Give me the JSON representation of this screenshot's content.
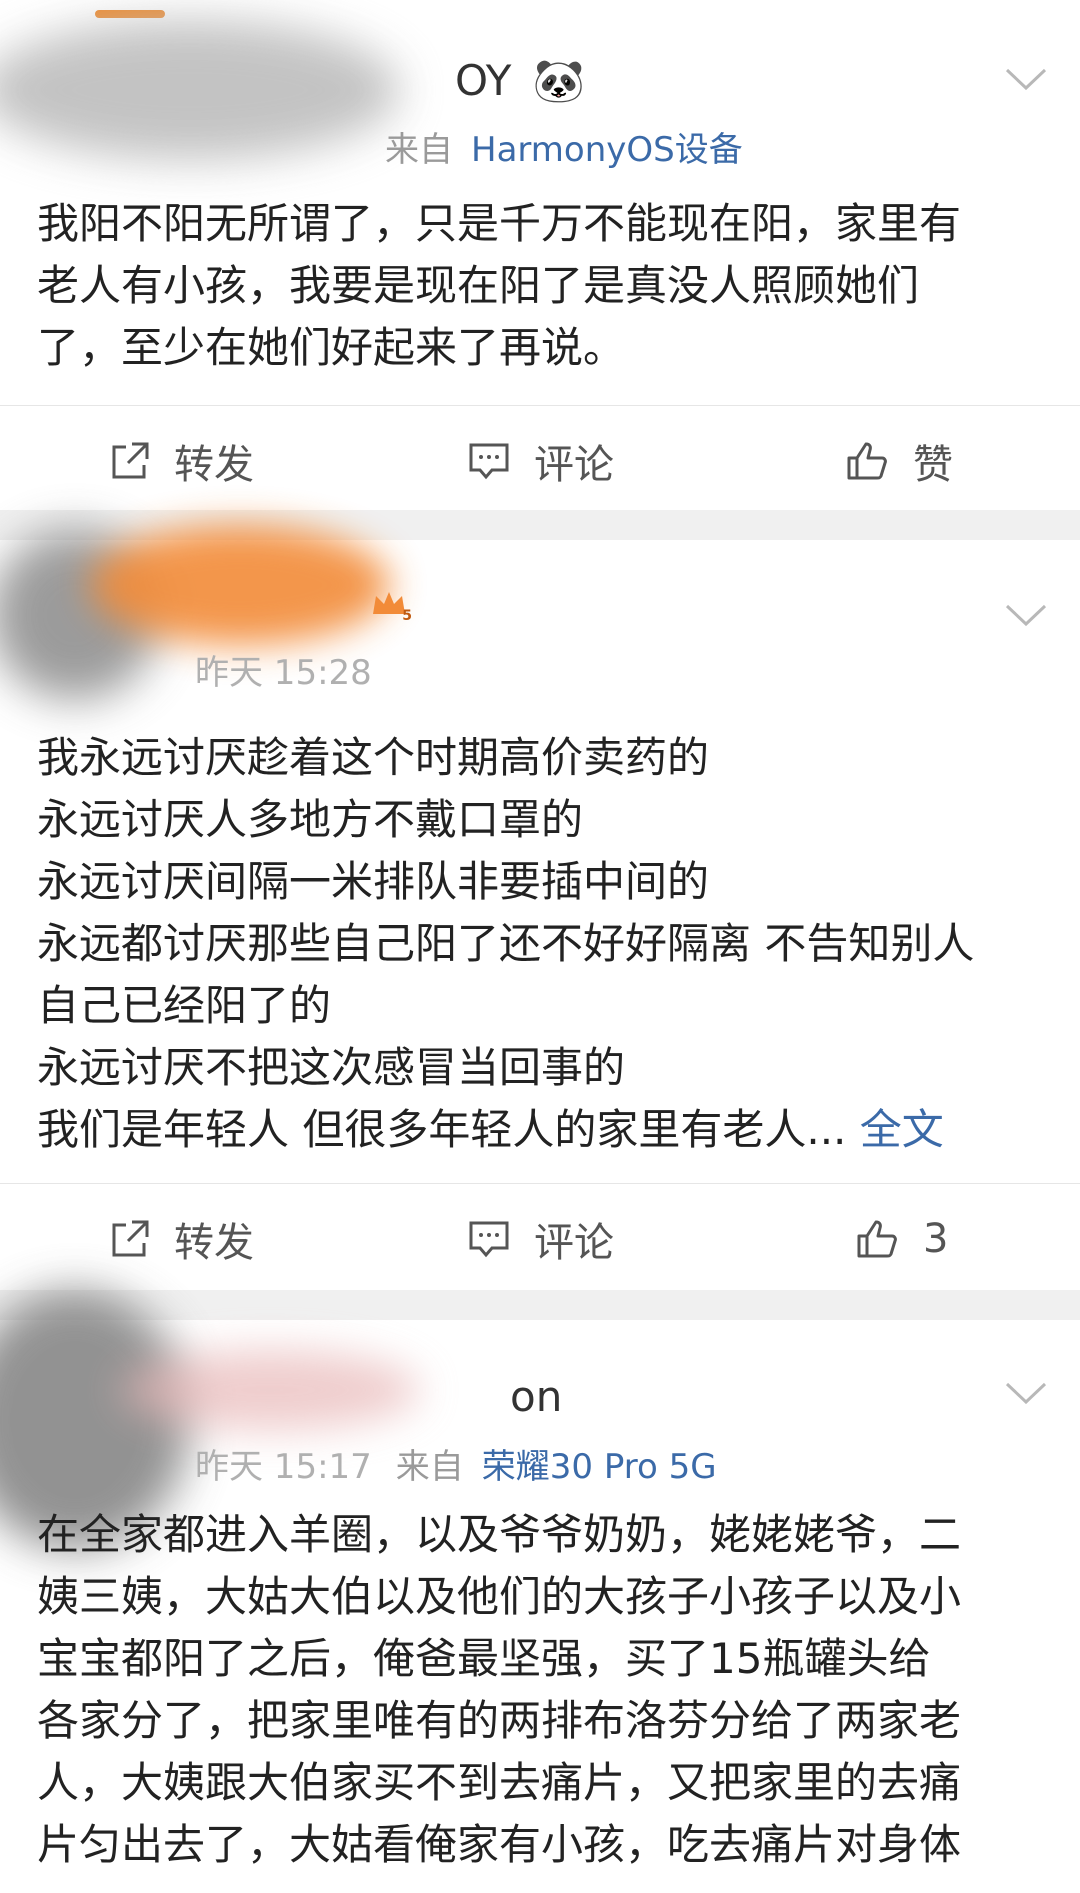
{
  "post1": {
    "username_partial": "OY",
    "badge_emoji": "🐼",
    "source_prefix": "来自",
    "source": "HarmonyOS设备",
    "content_lines": [
      "我阳不阳无所谓了，只是千万不能现在阳，家里有",
      "老人有小孩，我要是现在阳了是真没人照顾她们",
      "了，至少在她们好起来了再说。"
    ],
    "actions": {
      "forward": "转发",
      "comment": "评论",
      "like": "赞"
    }
  },
  "post2": {
    "time": "昨天 15:28",
    "badge_level": "5",
    "content_lines": [
      "我永远讨厌趁着这个时期高价卖药的",
      "永远讨厌人多地方不戴口罩的",
      "永远讨厌间隔一米排队非要插中间的",
      "永远都讨厌那些自己阳了还不好好隔离 不告知别人",
      "自己已经阳了的",
      "永远讨厌不把这次感冒当回事的",
      "我们是年轻人 但很多年轻人的家里有老人..."
    ],
    "full_text_link": "全文",
    "actions": {
      "forward": "转发",
      "comment": "评论",
      "like_count": "3"
    }
  },
  "post3": {
    "username_partial": "on",
    "time": "昨天 15:17",
    "source_prefix": "来自",
    "source": "荣耀30 Pro 5G",
    "content_lines": [
      "在全家都进入羊圈，以及爷爷奶奶，姥姥姥爷，二",
      "姨三姨，大姑大伯以及他们的大孩子小孩子以及小",
      "宝宝都阳了之后，俺爸最坚强，买了15瓶罐头给",
      "各家分了，把家里唯有的两排布洛芬分给了两家老",
      "人，大姨跟大伯家买不到去痛片，又把家里的去痛",
      "片匀出去了，大姑看俺家有小孩，吃去痛片对身体"
    ]
  },
  "colors": {
    "link": "#3b6aa8",
    "meta": "#9a9a9a",
    "separator": "#f0f0f0"
  }
}
